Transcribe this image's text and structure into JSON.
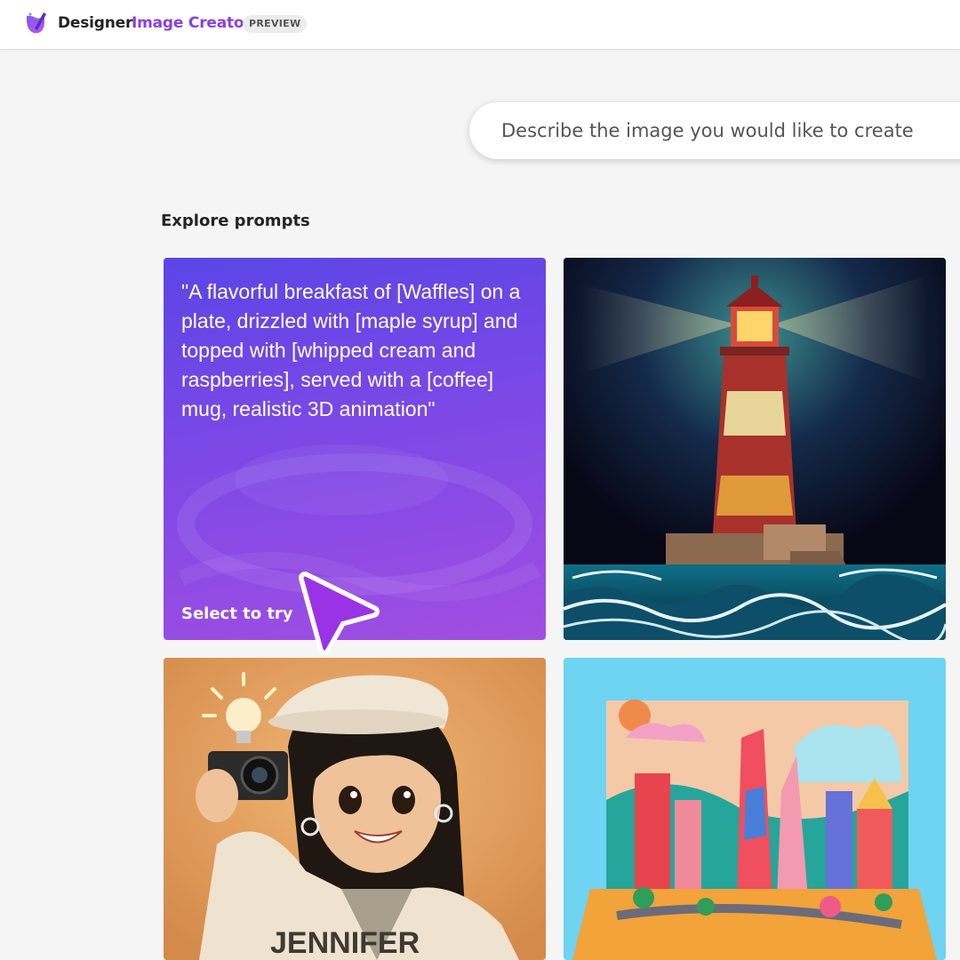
{
  "header": {
    "brand": "Designer",
    "product": "Image Creator",
    "badge": "PREVIEW"
  },
  "search": {
    "placeholder": "Describe the image you would like to create"
  },
  "explore": {
    "title": "Explore prompts",
    "prompt_card": {
      "text": "\"A flavorful breakfast of [Waffles] on a plate, drizzled with [maple syrup] and topped with [whipped cream and raspberries], served with a [coffee] mug, realistic 3D animation\"",
      "cta": "Select to try"
    },
    "girl_card": {
      "jacket_text": "JENNIFER"
    }
  },
  "colors": {
    "accent": "#8a3fe0",
    "card_gradient_start": "#5b45e6",
    "card_gradient_end": "#a24ee2"
  },
  "icons": [
    "designer-logo-icon",
    "cursor-pointer-icon"
  ]
}
